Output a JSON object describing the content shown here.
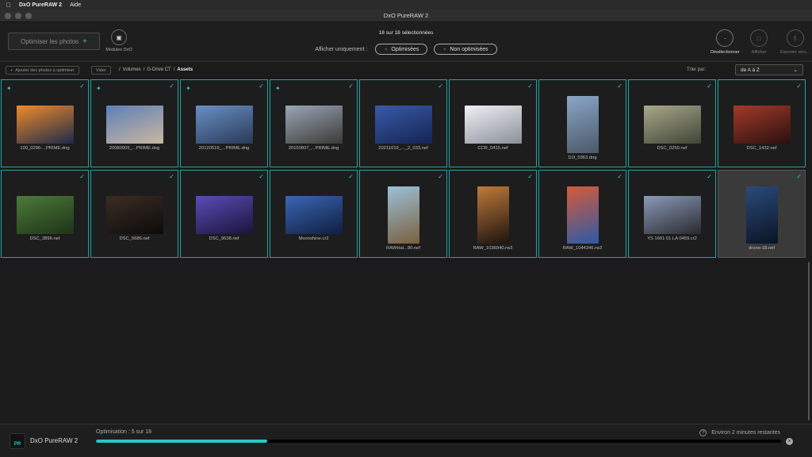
{
  "menubar": {
    "apple": "",
    "app": "DxO PureRAW 2",
    "items": [
      "Aide"
    ]
  },
  "window": {
    "title": "DxO PureRAW 2"
  },
  "toolbar": {
    "optimize_label": "Optimiser les photos",
    "modules_label": "Modules DxO",
    "selection_count": "18 sur 18 sélectionnées",
    "filter_label": "Afficher uniquement :",
    "filter_optimized": "Optimisées",
    "filter_not_optimized": "Non optimisées",
    "deselect_label": "Désélectionner",
    "show_label": "Afficher",
    "export_label": "Exporter vers..."
  },
  "pathbar": {
    "add_label": "Ajouter des photos à optimiser",
    "clear_label": "Vider",
    "breadcrumb": [
      "Volumes",
      "G-Drive CT",
      "Assets"
    ],
    "sort_label": "Trier par:",
    "sort_value": "de A à Z"
  },
  "colors": {
    "accent": "#27c8c8",
    "border": "#1fa6a6",
    "bg": "#1b1b1b"
  },
  "photos": [
    {
      "name": "100_0296-...PRIME.dng",
      "starred": true,
      "checked": true,
      "selected": false,
      "orient": "land",
      "c1": "#f08a2a",
      "c2": "#1d2b4a"
    },
    {
      "name": "20080905_...PRIME.dng",
      "starred": true,
      "checked": true,
      "selected": false,
      "orient": "land",
      "c1": "#5d7fb8",
      "c2": "#c9b7a1"
    },
    {
      "name": "20120519_...PRIME.dng",
      "starred": true,
      "checked": true,
      "selected": false,
      "orient": "land",
      "c1": "#6a8fc4",
      "c2": "#283a58"
    },
    {
      "name": "20150807_...PRIME.dng",
      "starred": true,
      "checked": true,
      "selected": false,
      "orient": "land",
      "c1": "#9aa6b6",
      "c2": "#3b3a36"
    },
    {
      "name": "20211019_..._2_033.nef",
      "starred": false,
      "checked": true,
      "selected": false,
      "orient": "land",
      "c1": "#3a5aa8",
      "c2": "#142455"
    },
    {
      "name": "CCR_0415.nef",
      "starred": false,
      "checked": true,
      "selected": false,
      "orient": "land",
      "c1": "#eef0f4",
      "c2": "#8a8f99"
    },
    {
      "name": "DJI_0363.dng",
      "starred": false,
      "checked": true,
      "selected": false,
      "orient": "port",
      "c1": "#8aa6c8",
      "c2": "#4b5966"
    },
    {
      "name": "DSC_0250.nef",
      "starred": false,
      "checked": true,
      "selected": false,
      "orient": "land",
      "c1": "#a9a78a",
      "c2": "#3f4536"
    },
    {
      "name": "DSC_1432.nef",
      "starred": false,
      "checked": true,
      "selected": false,
      "orient": "land",
      "c1": "#a33a2a",
      "c2": "#2a1010"
    },
    {
      "name": "DSC_3896.nef",
      "starred": false,
      "checked": true,
      "selected": false,
      "orient": "land",
      "c1": "#4d7a3a",
      "c2": "#1e3318"
    },
    {
      "name": "DSC_5686.nef",
      "starred": false,
      "checked": true,
      "selected": false,
      "orient": "land",
      "c1": "#3d2d24",
      "c2": "#0b0b0b"
    },
    {
      "name": "DSC_9638.nef",
      "starred": false,
      "checked": true,
      "selected": false,
      "orient": "land",
      "c1": "#5b4cb8",
      "c2": "#1a1438"
    },
    {
      "name": "Moonshine.cr2",
      "starred": false,
      "checked": true,
      "selected": false,
      "orient": "land",
      "c1": "#3b66b5",
      "c2": "#0f1e40"
    },
    {
      "name": "RAWHal...90.nef",
      "starred": false,
      "checked": true,
      "selected": false,
      "orient": "port",
      "c1": "#9cc0d8",
      "c2": "#7a5f3e"
    },
    {
      "name": "RAW_1036940.rw2",
      "starred": false,
      "checked": true,
      "selected": false,
      "orient": "port",
      "c1": "#c07a3a",
      "c2": "#1c1410"
    },
    {
      "name": "RAW_1044346.rw2",
      "starred": false,
      "checked": true,
      "selected": false,
      "orient": "port",
      "c1": "#d65a3a",
      "c2": "#2c5aa8"
    },
    {
      "name": "YS 1601 01 LA 0459.cr2",
      "starred": false,
      "checked": true,
      "selected": false,
      "orient": "land",
      "c1": "#8a9ab8",
      "c2": "#2a2a30"
    },
    {
      "name": "drone-18.nef",
      "starred": false,
      "checked": true,
      "selected": true,
      "orient": "port",
      "c1": "#2a4a7a",
      "c2": "#0b1426"
    }
  ],
  "footer": {
    "logo_text": "PR",
    "app_name": "DxO PureRAW 2",
    "progress_label": "Optimisation : 5 sur 18",
    "progress": 0.25,
    "remaining": "Environ 2 minutes restantes"
  }
}
